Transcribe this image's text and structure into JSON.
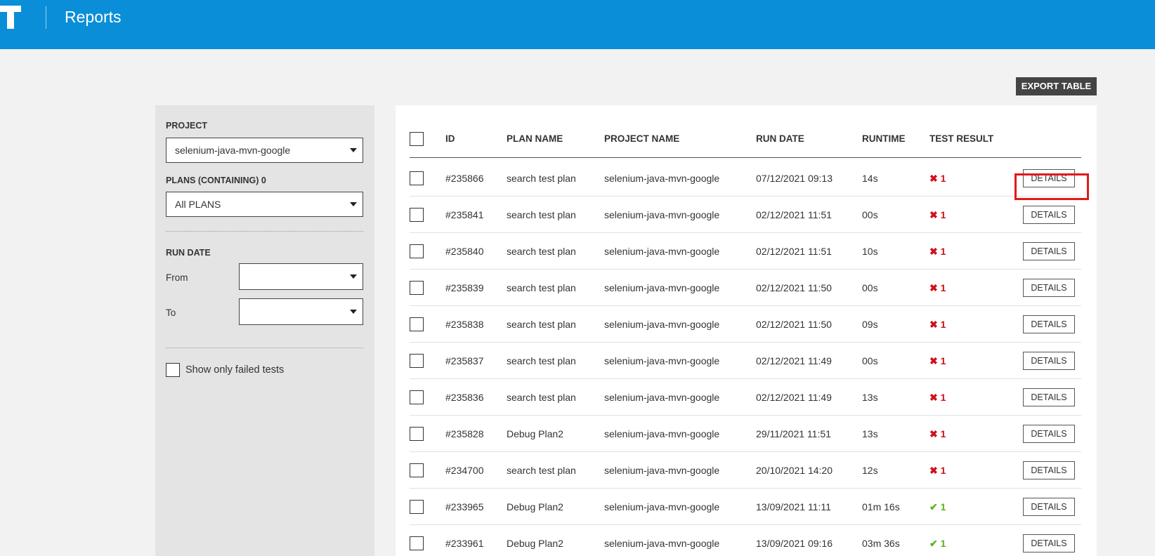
{
  "app": {
    "title": "Reports"
  },
  "toolbar": {
    "export_label": "EXPORT TABLE"
  },
  "filters": {
    "project_label": "PROJECT",
    "project_value": "selenium-java-mvn-google",
    "plans_label": "PLANS (CONTAINING) 0",
    "plans_value": "All PLANS",
    "run_date_label": "RUN DATE",
    "from_label": "From",
    "to_label": "To",
    "show_failed_label": "Show only failed tests"
  },
  "table": {
    "headers": [
      "ID",
      "PLAN NAME",
      "PROJECT NAME",
      "RUN DATE",
      "RUNTIME",
      "TEST RESULT"
    ],
    "details_label": "DETAILS",
    "rows": [
      {
        "id": "#235866",
        "plan": "search test plan",
        "project": "selenium-java-mvn-google",
        "date": "07/12/2021 09:13",
        "runtime": "14s",
        "result_icon": "✖",
        "result_count": "1",
        "status": "failed"
      },
      {
        "id": "#235841",
        "plan": "search test plan",
        "project": "selenium-java-mvn-google",
        "date": "02/12/2021 11:51",
        "runtime": "00s",
        "result_icon": "✖",
        "result_count": "1",
        "status": "failed"
      },
      {
        "id": "#235840",
        "plan": "search test plan",
        "project": "selenium-java-mvn-google",
        "date": "02/12/2021 11:51",
        "runtime": "10s",
        "result_icon": "✖",
        "result_count": "1",
        "status": "failed"
      },
      {
        "id": "#235839",
        "plan": "search test plan",
        "project": "selenium-java-mvn-google",
        "date": "02/12/2021 11:50",
        "runtime": "00s",
        "result_icon": "✖",
        "result_count": "1",
        "status": "failed"
      },
      {
        "id": "#235838",
        "plan": "search test plan",
        "project": "selenium-java-mvn-google",
        "date": "02/12/2021 11:50",
        "runtime": "09s",
        "result_icon": "✖",
        "result_count": "1",
        "status": "failed"
      },
      {
        "id": "#235837",
        "plan": "search test plan",
        "project": "selenium-java-mvn-google",
        "date": "02/12/2021 11:49",
        "runtime": "00s",
        "result_icon": "✖",
        "result_count": "1",
        "status": "failed"
      },
      {
        "id": "#235836",
        "plan": "search test plan",
        "project": "selenium-java-mvn-google",
        "date": "02/12/2021 11:49",
        "runtime": "13s",
        "result_icon": "✖",
        "result_count": "1",
        "status": "failed"
      },
      {
        "id": "#235828",
        "plan": "Debug Plan2",
        "project": "selenium-java-mvn-google",
        "date": "29/11/2021 11:51",
        "runtime": "13s",
        "result_icon": "✖",
        "result_count": "1",
        "status": "failed"
      },
      {
        "id": "#234700",
        "plan": "search test plan",
        "project": "selenium-java-mvn-google",
        "date": "20/10/2021 14:20",
        "runtime": "12s",
        "result_icon": "✖",
        "result_count": "1",
        "status": "failed"
      },
      {
        "id": "#233965",
        "plan": "Debug Plan2",
        "project": "selenium-java-mvn-google",
        "date": "13/09/2021 11:11",
        "runtime": "01m 16s",
        "result_icon": "✔",
        "result_count": "1",
        "status": "passed"
      },
      {
        "id": "#233961",
        "plan": "Debug Plan2",
        "project": "selenium-java-mvn-google",
        "date": "13/09/2021 09:16",
        "runtime": "03m 36s",
        "result_icon": "✔",
        "result_count": "1",
        "status": "passed"
      }
    ]
  },
  "colors": {
    "header": "#0a8ed8",
    "failed": "#d0101b",
    "passed": "#5ab31e",
    "highlight": "#e11919"
  }
}
